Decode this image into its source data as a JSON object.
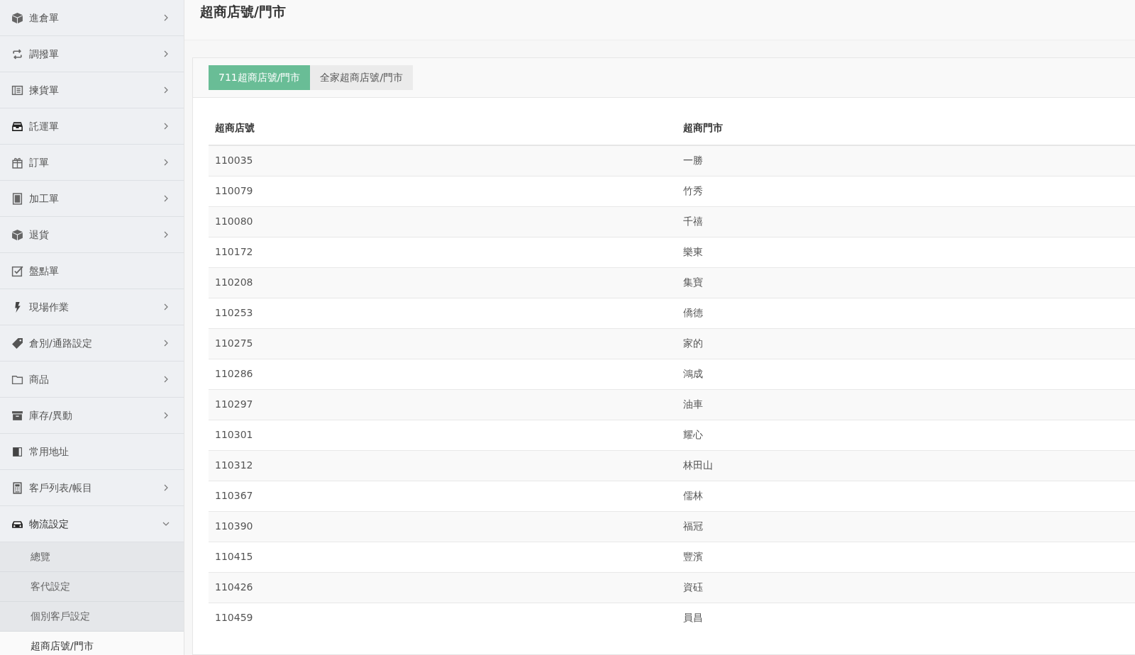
{
  "sidebar": {
    "items": [
      {
        "label": "進倉單",
        "expandable": true,
        "expanded": false
      },
      {
        "label": "調撥單",
        "expandable": true,
        "expanded": false
      },
      {
        "label": "揀貨單",
        "expandable": true,
        "expanded": false
      },
      {
        "label": "託運單",
        "expandable": true,
        "expanded": false
      },
      {
        "label": "訂單",
        "expandable": true,
        "expanded": false
      },
      {
        "label": "加工單",
        "expandable": true,
        "expanded": false
      },
      {
        "label": "退貨",
        "expandable": true,
        "expanded": false
      },
      {
        "label": "盤點單",
        "expandable": false,
        "expanded": false
      },
      {
        "label": "現場作業",
        "expandable": true,
        "expanded": false
      },
      {
        "label": "倉別/通路設定",
        "expandable": true,
        "expanded": false
      },
      {
        "label": "商品",
        "expandable": true,
        "expanded": false
      },
      {
        "label": "庫存/異動",
        "expandable": true,
        "expanded": false
      },
      {
        "label": "常用地址",
        "expandable": false,
        "expanded": false
      },
      {
        "label": "客戶列表/帳目",
        "expandable": true,
        "expanded": false
      },
      {
        "label": "物流設定",
        "expandable": true,
        "expanded": true,
        "children": [
          {
            "label": "總覽",
            "selected": false
          },
          {
            "label": "客代設定",
            "selected": false
          },
          {
            "label": "個別客戶設定",
            "selected": false
          },
          {
            "label": "超商店號/門市",
            "selected": true
          }
        ]
      }
    ]
  },
  "page_title": "超商店號/門市",
  "tabs": [
    {
      "label": "711超商店號/門市",
      "selected": true
    },
    {
      "label": "全家超商店號/門市",
      "selected": false
    }
  ],
  "table": {
    "columns": [
      "超商店號",
      "超商門市"
    ],
    "rows": [
      [
        "110035",
        "一勝"
      ],
      [
        "110079",
        "竹秀"
      ],
      [
        "110080",
        "千禧"
      ],
      [
        "110172",
        "樂東"
      ],
      [
        "110208",
        "集寶"
      ],
      [
        "110253",
        "僑德"
      ],
      [
        "110275",
        "家的"
      ],
      [
        "110286",
        "鴻成"
      ],
      [
        "110297",
        "油車"
      ],
      [
        "110301",
        "耀心"
      ],
      [
        "110312",
        "林田山"
      ],
      [
        "110367",
        "儒林"
      ],
      [
        "110390",
        "福冠"
      ],
      [
        "110415",
        "豐濱"
      ],
      [
        "110426",
        "資砡"
      ],
      [
        "110459",
        "員昌"
      ]
    ]
  }
}
